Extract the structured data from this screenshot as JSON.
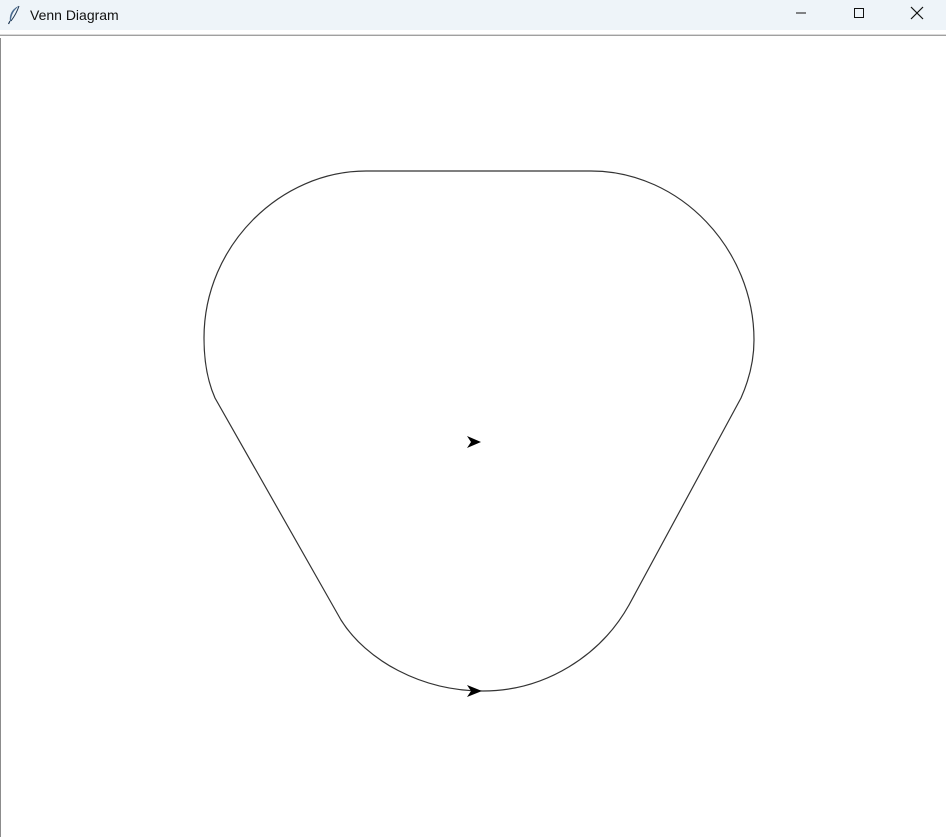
{
  "window": {
    "title": "Venn Diagram",
    "app_icon": "feather-icon",
    "controls": {
      "minimize_icon": "minimize-icon",
      "maximize_icon": "maximize-icon",
      "close_icon": "close-icon"
    }
  },
  "canvas": {
    "background": "#ffffff",
    "shape": {
      "kind": "rounded-triangle-outline",
      "stroke": "#333333"
    },
    "turtle_markers": [
      "arrow-cursor-icon",
      "arrow-cursor-icon"
    ]
  }
}
